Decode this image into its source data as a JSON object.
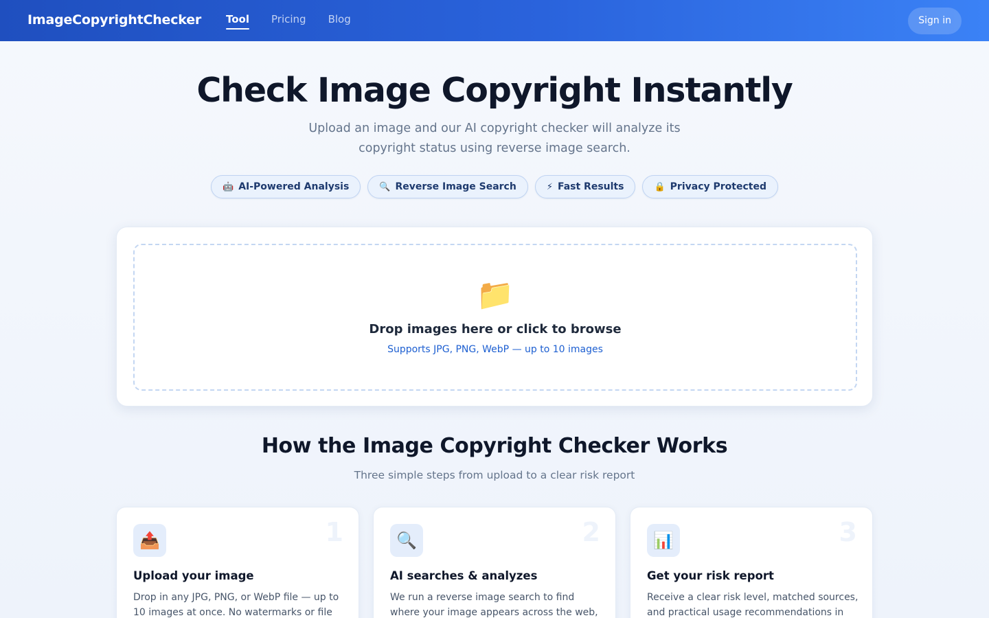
{
  "header": {
    "brand": "ImageCopyrightChecker",
    "nav": [
      {
        "label": "Tool",
        "active": true
      },
      {
        "label": "Pricing",
        "active": false
      },
      {
        "label": "Blog",
        "active": false
      }
    ],
    "signin_label": "Sign in"
  },
  "hero": {
    "title": "Check Image Copyright Instantly",
    "subtitle": "Upload an image and our AI copyright checker will analyze its copyright status using reverse image search.",
    "chips": [
      {
        "icon": "🤖",
        "icon_name": "robot-icon",
        "label": "AI-Powered Analysis"
      },
      {
        "icon": "🔍",
        "icon_name": "magnifier-icon",
        "label": "Reverse Image Search"
      },
      {
        "icon": "⚡",
        "icon_name": "lightning-icon",
        "label": "Fast Results"
      },
      {
        "icon": "🔒",
        "icon_name": "lock-icon",
        "label": "Privacy Protected"
      }
    ]
  },
  "upload": {
    "icon": "📁",
    "icon_name": "folder-icon",
    "title": "Drop images here or click to browse",
    "subtitle": "Supports JPG, PNG, WebP — up to 10 images"
  },
  "how": {
    "title": "How the Image Copyright Checker Works",
    "subtitle": "Three simple steps from upload to a clear risk report",
    "steps": [
      {
        "number": "1",
        "icon": "📤",
        "icon_name": "upload-tray-icon",
        "title": "Upload your image",
        "desc": "Drop in any JPG, PNG, or WebP file — up to 10 images at once. No watermarks or file"
      },
      {
        "number": "2",
        "icon": "🔍",
        "icon_name": "magnifier-icon",
        "title": "AI searches & analyzes",
        "desc": "We run a reverse image search to find where your image appears across the web, then AI"
      },
      {
        "number": "3",
        "icon": "📊",
        "icon_name": "bar-chart-icon",
        "title": "Get your risk report",
        "desc": "Receive a clear risk level, matched sources, and practical usage recommendations in"
      }
    ]
  },
  "colors": {
    "header_start": "#1f4fbf",
    "header_end": "#3b82f6",
    "accent_link": "#1d5fd1",
    "title_text": "#0f172a"
  }
}
